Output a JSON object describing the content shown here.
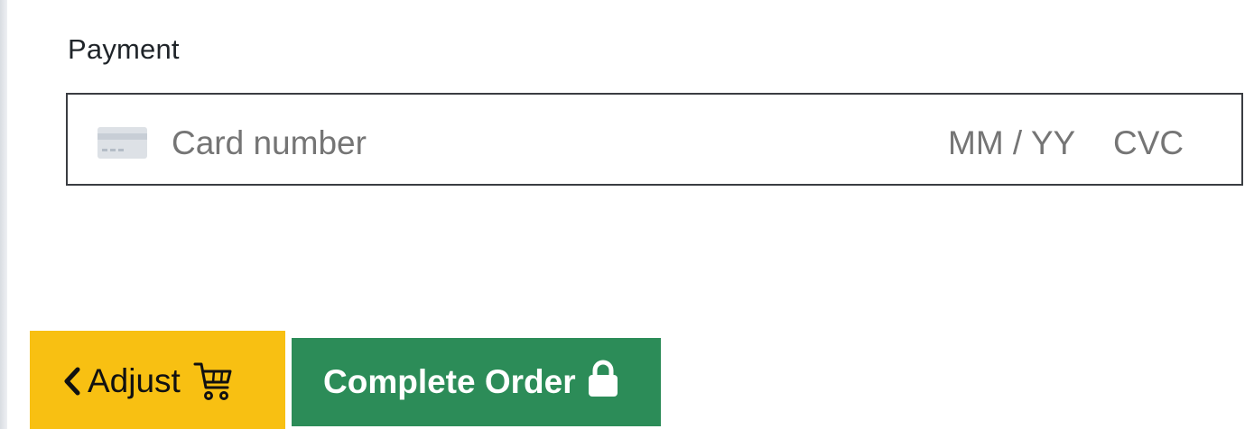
{
  "payment": {
    "label": "Payment",
    "card_number_placeholder": "Card number",
    "expiry_placeholder": "MM / YY",
    "cvc_placeholder": "CVC",
    "card_icon": "credit-card-icon"
  },
  "actions": {
    "adjust": {
      "label": "Adjust",
      "icons": [
        "chevron-left-icon",
        "cart-icon"
      ],
      "color": "#f8c012"
    },
    "complete": {
      "label": "Complete Order",
      "icon": "lock-icon",
      "color": "#2c8c58"
    }
  }
}
